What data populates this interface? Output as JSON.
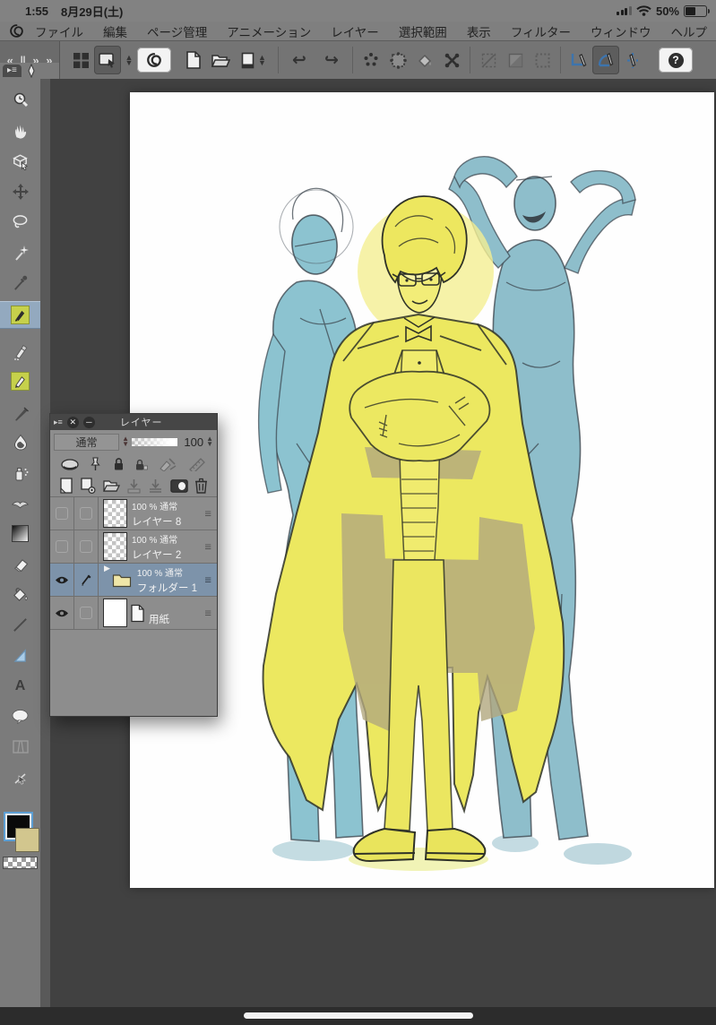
{
  "status_bar": {
    "time": "1:55",
    "date": "8月29日(土)",
    "battery_percent": "50%"
  },
  "menu_bar": {
    "items": [
      "ファイル",
      "編集",
      "ページ管理",
      "アニメーション",
      "レイヤー",
      "選択範囲",
      "表示",
      "フィルター",
      "ウィンドウ",
      "ヘルプ"
    ]
  },
  "toolbar": {
    "help_label": "?",
    "undo_glyph": "↩",
    "redo_glyph": "↪",
    "chevrons": [
      "«",
      "‖",
      "»",
      "»"
    ],
    "icons": [
      "workspace-grid",
      "pointer-window",
      "size-spinner",
      "clip-studio-home",
      "new-canvas",
      "open-file",
      "page-switcher",
      "undo",
      "redo",
      "deselect",
      "select-marquee",
      "fill-selection",
      "transform",
      "crop-disabled",
      "rotate-disabled",
      "clear-disabled",
      "snap-to-ruler",
      "snap-to-special-ruler",
      "snap-to-grid",
      "help"
    ]
  },
  "tool_palette": {
    "text_tool_glyph": "A",
    "tools": [
      "zoom",
      "hand",
      "operate",
      "move-layer",
      "lasso",
      "auto-select",
      "eyedropper",
      "pen",
      "marker",
      "pencil",
      "brush",
      "watercolor",
      "airbrush",
      "decoration",
      "gradient",
      "eraser",
      "fill",
      "figure",
      "ruler",
      "text",
      "balloon",
      "frame-border",
      "correct-line"
    ],
    "selected_tool": "pen",
    "foreground_color": "#0a0a0a",
    "background_color": "#d2c68e"
  },
  "layer_palette": {
    "title": "レイヤー",
    "blend_mode": "通常",
    "opacity_value": "100",
    "layers": [
      {
        "meta": "100 % 通常",
        "name": "レイヤー 8",
        "visible": false,
        "selected": false,
        "type": "raster"
      },
      {
        "meta": "100 % 通常",
        "name": "レイヤー 2",
        "visible": false,
        "selected": false,
        "type": "raster"
      },
      {
        "meta": "100 % 通常",
        "name": "フォルダー 1",
        "visible": true,
        "selected": true,
        "editing": true,
        "type": "folder"
      },
      {
        "meta": "",
        "name": "用紙",
        "visible": true,
        "selected": false,
        "type": "paper"
      }
    ]
  },
  "canvas": {
    "figures": [
      "blue-sketch-figure-left",
      "yellow-coat-man-center",
      "blue-sketch-figure-right"
    ]
  },
  "colors": {
    "status_menu_bar": "#828282",
    "toolbar": "#747474",
    "canvas_background": "#414141",
    "page": "#fefefe",
    "palette_body": "#8d8d8d",
    "palette_titlebar": "#464646",
    "selected_layer_row": "#7d93aa",
    "tool_selected_highlight": "#93a9bf",
    "figure_blue": "#8cc3d0",
    "figure_yellow": "#ece860",
    "shading_tan": "#b2a87e",
    "accent_blue_icons": "#3d74ad"
  }
}
